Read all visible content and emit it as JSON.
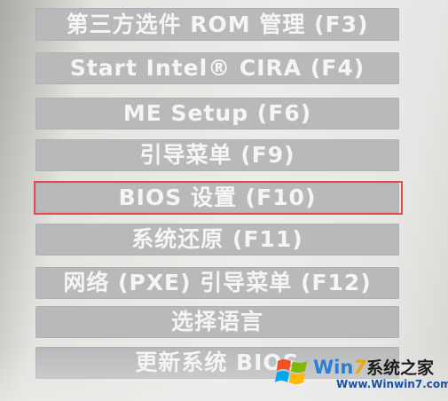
{
  "boot_menu": {
    "items": [
      {
        "label": "第三方选件 ROM 管理 (F3)"
      },
      {
        "label": "Start Intel® CIRA (F4)"
      },
      {
        "label": "ME Setup (F6)"
      },
      {
        "label": "引导菜单 (F9)"
      },
      {
        "label": "BIOS 设置 (F10)",
        "highlighted": true
      },
      {
        "label": "系统还原 (F11)"
      },
      {
        "label": "网络 (PXE) 引导菜单 (F12)"
      },
      {
        "label": "选择语言"
      },
      {
        "label": "更新系统 BIOS"
      }
    ],
    "highlight_color": "#e3494d",
    "button_color": "#b8b9bb",
    "text_color": "#f4f5f6"
  },
  "watermark": {
    "logo": "windows-flag-icon",
    "brand_win": "Win",
    "brand_seven": "7",
    "brand_cn": "系统之家",
    "url": "Www.Winwin7.com"
  }
}
